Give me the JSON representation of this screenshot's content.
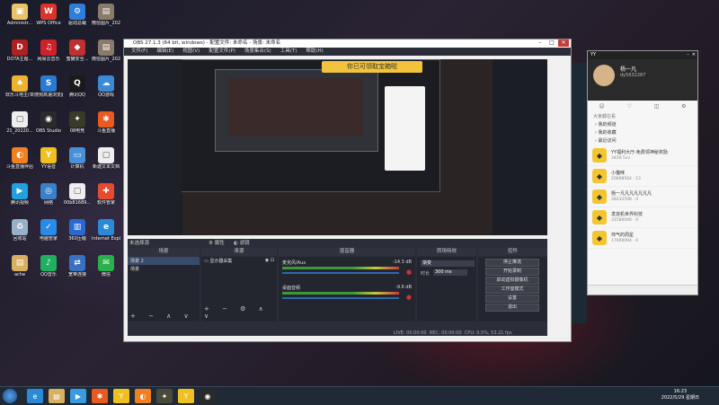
{
  "desktop_icons": [
    {
      "label": "Administr...",
      "color": "#e8c36a",
      "glyph": "▣"
    },
    {
      "label": "WPS Office",
      "color": "#d9342b",
      "glyph": "W"
    },
    {
      "label": "驱动总裁",
      "color": "#2f7fd9",
      "glyph": "⚙"
    },
    {
      "label": "微信图片_20220402...",
      "color": "#8a7a6a",
      "glyph": "▤"
    },
    {
      "label": "DOTA主题...",
      "color": "#b02020",
      "glyph": "D"
    },
    {
      "label": "网易云音乐",
      "color": "#d0202a",
      "glyph": "♫"
    },
    {
      "label": "蜜獾安全...",
      "color": "#c03030",
      "glyph": "◆"
    },
    {
      "label": "微信图片_20220402...",
      "color": "#8a7a6a",
      "glyph": "▤"
    },
    {
      "label": "欢乐斗地主(单机版)",
      "color": "#f0b030",
      "glyph": "♠"
    },
    {
      "label": "搜狗高速浏览器",
      "color": "#2a7ad0",
      "glyph": "S"
    },
    {
      "label": "腾讯QQ",
      "color": "#1a1a1a",
      "glyph": "Q"
    },
    {
      "label": "QQ游戏",
      "color": "#3a8ad8",
      "glyph": "☁"
    },
    {
      "label": "21_20220...",
      "color": "#eeeeee",
      "glyph": "▢"
    },
    {
      "label": "OBS Studio",
      "color": "#2a2a2a",
      "glyph": "◉"
    },
    {
      "label": "08电竞",
      "color": "#3a3a2a",
      "glyph": "✦"
    },
    {
      "label": "斗鱼直播",
      "color": "#e85a20",
      "glyph": "✱"
    },
    {
      "label": "斗鱼直播伴侣",
      "color": "#f08020",
      "glyph": "◐"
    },
    {
      "label": "YY语音",
      "color": "#f0c020",
      "glyph": "Y"
    },
    {
      "label": "计算机",
      "color": "#4a90d8",
      "glyph": "▭"
    },
    {
      "label": "新建文本文档",
      "color": "#eeeeee",
      "glyph": "▢"
    },
    {
      "label": "腾讯视频",
      "color": "#20a0e0",
      "glyph": "▶"
    },
    {
      "label": "网络",
      "color": "#3a80c8",
      "glyph": "◎"
    },
    {
      "label": "00b81689...",
      "color": "#eeeeee",
      "glyph": "▢"
    },
    {
      "label": "软件管家",
      "color": "#e84a30",
      "glyph": "✚"
    },
    {
      "label": "回收站",
      "color": "#9ab0c8",
      "glyph": "♻"
    },
    {
      "label": "电脑管家",
      "color": "#2a8ae8",
      "glyph": "✓"
    },
    {
      "label": "360压缩",
      "color": "#2a6ad0",
      "glyph": "▥"
    },
    {
      "label": "Internet Explorer",
      "color": "#2a8ad8",
      "glyph": "e"
    },
    {
      "label": "ache",
      "color": "#d8b060",
      "glyph": "▤"
    },
    {
      "label": "QQ音乐",
      "color": "#20b060",
      "glyph": "♪"
    },
    {
      "label": "宽带连接",
      "color": "#3a70c0",
      "glyph": "⇄"
    },
    {
      "label": "微信",
      "color": "#2ab04a",
      "glyph": "✉"
    }
  ],
  "obs": {
    "title": "OBS 27.1.3 (64 bit, windows) - 配置文件: 未命名 - 场景: 未命名",
    "menu": [
      "文件(F)",
      "编辑(E)",
      "视图(V)",
      "配置文件(P)",
      "场景集合(S)",
      "工具(T)",
      "帮助(H)"
    ],
    "not_selected": "未选择源",
    "props_btn": "属性",
    "filter_btn": "滤镜",
    "panel_scenes": "场景",
    "panel_sources": "来源",
    "panel_mixer": "混音器",
    "panel_transitions": "转场特效",
    "panel_controls": "控件",
    "scenes": [
      "场景 2",
      "场景"
    ],
    "sources": [
      "显示器采集"
    ],
    "mixer_tracks": [
      {
        "name": "麦克风/Aux",
        "db": "-14.3 dB"
      },
      {
        "name": "桌面音频",
        "db": "-9.6 dB"
      }
    ],
    "transition": "渐变",
    "duration_label": "时长",
    "duration_value": "300 ms",
    "controls": [
      "停止推流",
      "开始录制",
      "启动虚拟摄像机",
      "工作室模式",
      "设置",
      "退出"
    ],
    "status": {
      "live": "LIVE: 00:00:00",
      "rec": "REC: 00:00:00",
      "cpu": "CPU: 0.5%, 53.21 fps"
    }
  },
  "inner_popup": "你已可领取宝箱啦",
  "yy": {
    "app_title": "YY",
    "username": "杨一凡",
    "user_id": "dy5632287",
    "tabs": [
      "☺",
      "♡",
      "◫",
      "⚙"
    ],
    "section": "大家都在看",
    "groups": [
      "我的频道",
      "我的收藏",
      "最近访问"
    ],
    "items": [
      {
        "name": "YY福利大厅-免费领神秘奖励",
        "sub": "3456 5vv"
      },
      {
        "name": "小猫咪",
        "sub": "20698564 · 13"
      },
      {
        "name": "杨一凡凡凡凡凡凡凡",
        "sub": "28232598 · 0"
      },
      {
        "name": "发烧机世界科技",
        "sub": "31580046 · 0"
      },
      {
        "name": "帅气的周星",
        "sub": "17000094 · 0"
      }
    ]
  },
  "taskbar": {
    "time": "16:23",
    "date": "2022/5/29 星期日",
    "apps": [
      {
        "glyph": "e",
        "color": "#2a8ad8"
      },
      {
        "glyph": "▤",
        "color": "#d8b060"
      },
      {
        "glyph": "▶",
        "color": "#3a9ae0"
      },
      {
        "glyph": "✱",
        "color": "#e85a20"
      },
      {
        "glyph": "Y",
        "color": "#f0c020"
      },
      {
        "glyph": "◐",
        "color": "#f08020"
      },
      {
        "glyph": "✦",
        "color": "#4a4a3a"
      },
      {
        "glyph": "Y",
        "color": "#f0c020"
      },
      {
        "glyph": "◉",
        "color": "#2a2a2a"
      }
    ]
  }
}
